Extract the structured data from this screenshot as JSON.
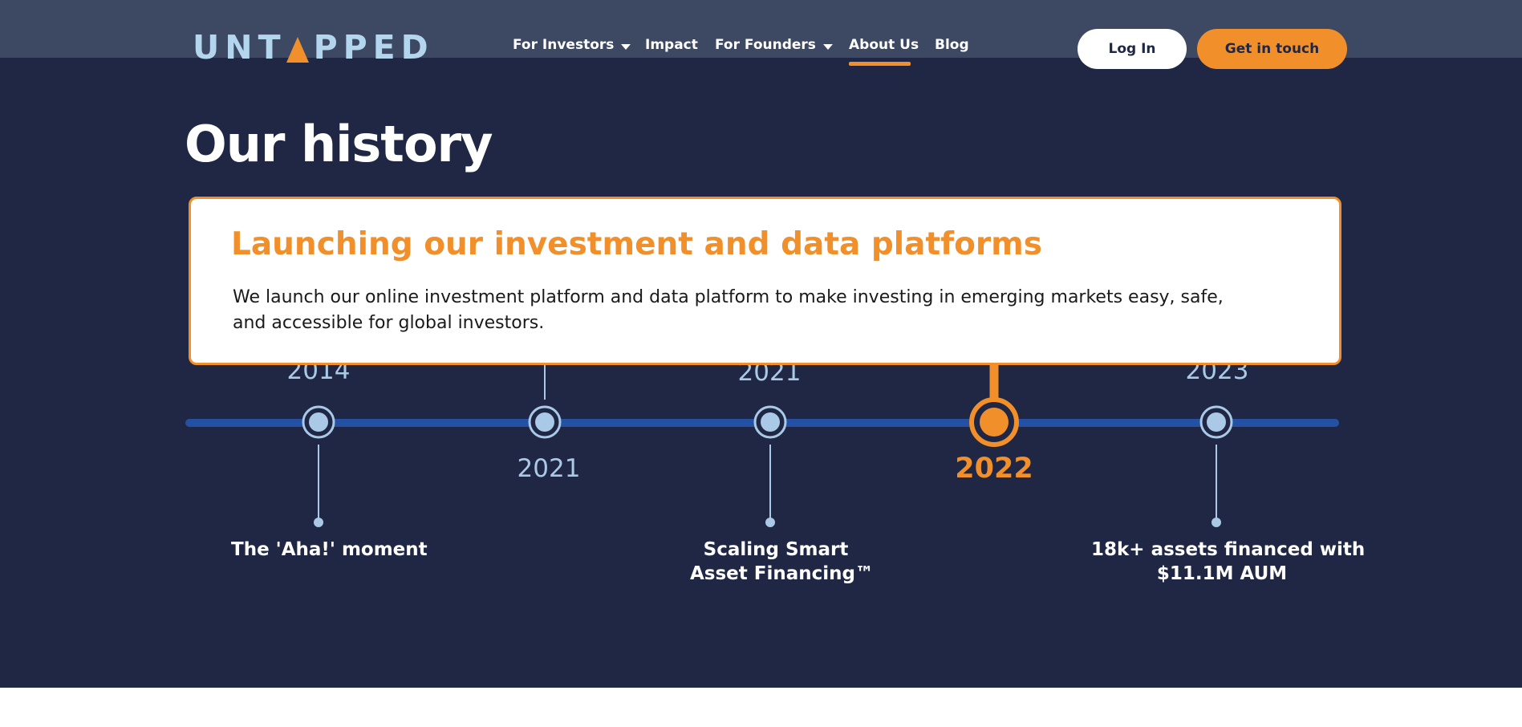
{
  "brand": {
    "logo_text_left": "UNT",
    "logo_text_right": "PPED",
    "logo_color": "#b3d6ee",
    "accent_color": "#f1902a"
  },
  "nav": {
    "items": [
      {
        "label": "For Investors",
        "dropdown": true
      },
      {
        "label": "Impact",
        "dropdown": false
      },
      {
        "label": "For Founders",
        "dropdown": true
      },
      {
        "label": "About Us",
        "dropdown": false,
        "active": true
      },
      {
        "label": "Blog",
        "dropdown": false
      }
    ],
    "login_label": "Log In",
    "cta_label": "Get in touch"
  },
  "page": {
    "title": "Our history",
    "background_color": "#1f2744"
  },
  "card": {
    "title": "Launching our investment and data platforms",
    "body": "We launch our online investment platform and data platform to make investing in emerging markets easy, safe, and accessible for global investors."
  },
  "timeline": {
    "years": [
      "2014",
      "2021",
      "2021",
      "2022",
      "2023"
    ],
    "active_index": 3,
    "milestones": [
      {
        "lines": [
          "The 'Aha!' moment"
        ]
      },
      {
        "lines": [
          "Scaling Smart",
          "Asset Financing™"
        ]
      },
      {
        "lines": [
          "18k+ assets financed with",
          "$11.1M AUM"
        ]
      }
    ],
    "line_color": "#2451a3",
    "node_color": "#a9c9e6"
  }
}
